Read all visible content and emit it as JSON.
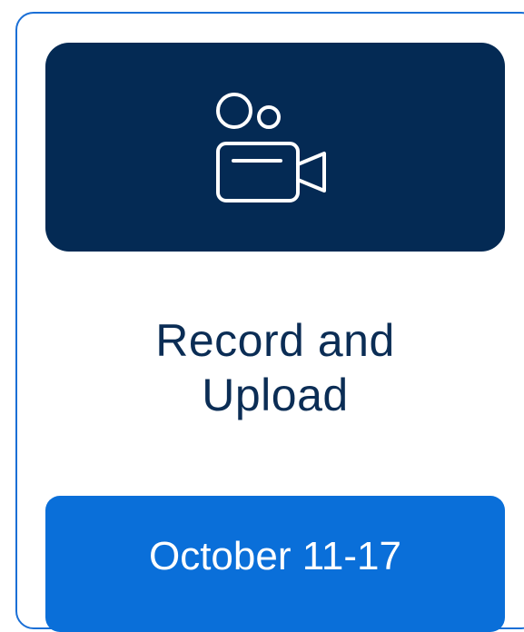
{
  "card": {
    "icon": "video-camera-icon",
    "title_line1": "Record and",
    "title_line2": "Upload",
    "date_label": "October 11-17"
  },
  "colors": {
    "border": "#1a6fd6",
    "icon_panel_bg": "#042a54",
    "title_text": "#0b2d55",
    "date_button_bg": "#0a6fd9",
    "date_button_text": "#ffffff"
  }
}
